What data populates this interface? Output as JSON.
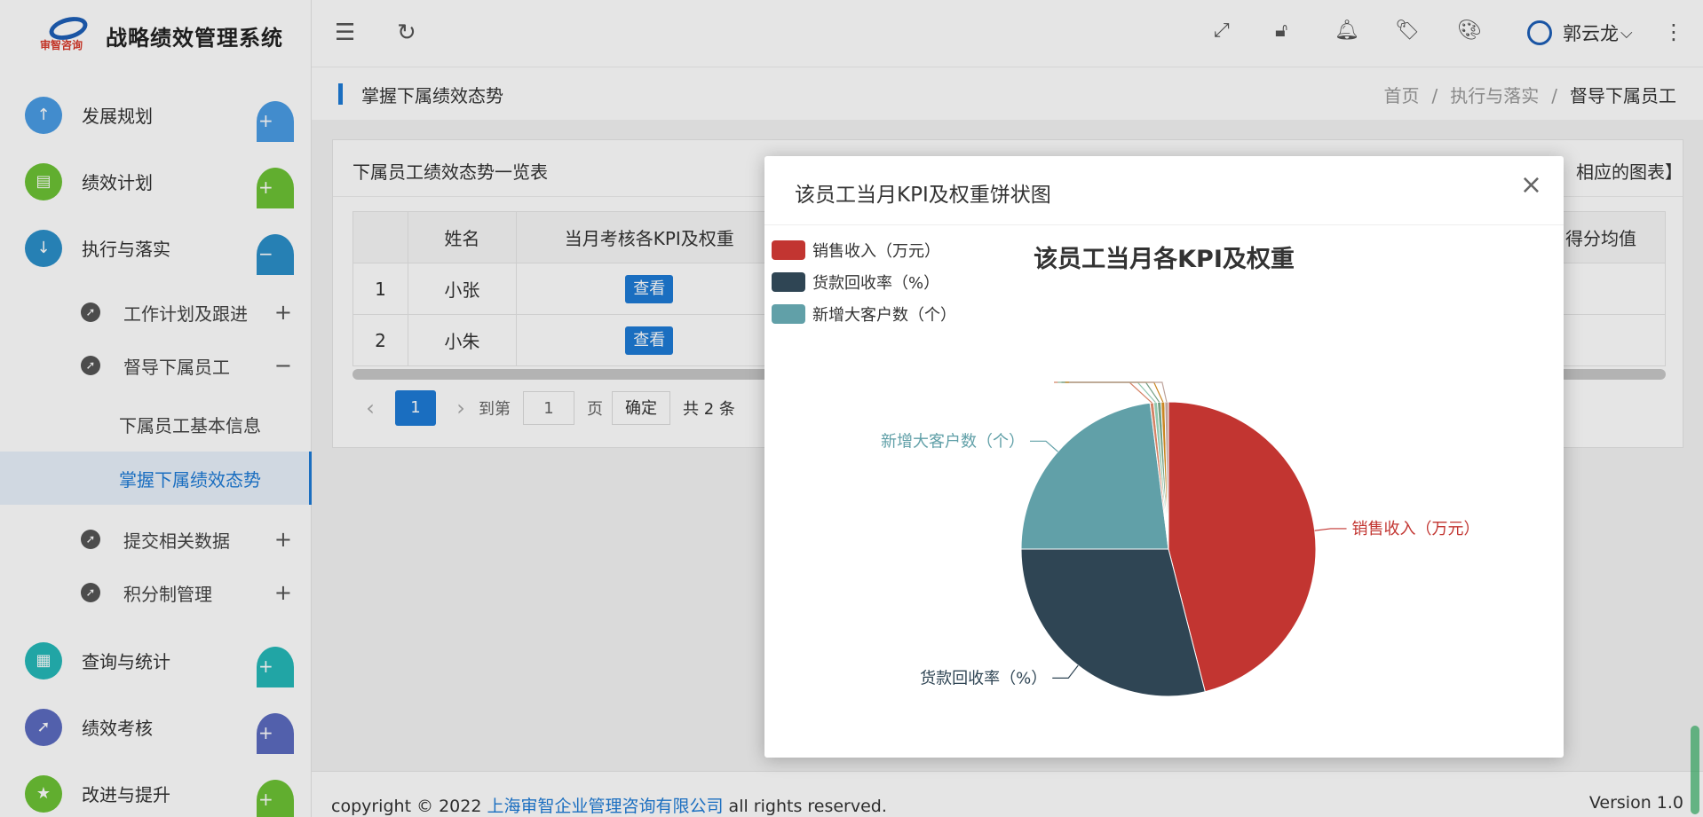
{
  "app": {
    "title": "战略绩效管理系统",
    "logo_text": "审智咨询"
  },
  "sidebar": {
    "items": [
      {
        "label": "发展规划",
        "color": "#4a9ce5"
      },
      {
        "label": "绩效计划",
        "color": "#6cc235"
      },
      {
        "label": "执行与落实",
        "color": "#2b8fc9"
      },
      {
        "label": "查询与统计",
        "color": "#25b8b8"
      },
      {
        "label": "绩效考核",
        "color": "#5c6bc0"
      },
      {
        "label": "改进与提升",
        "color": "#6cc235"
      }
    ],
    "sub_items": [
      {
        "label": "工作计划及跟进",
        "toggle": "+"
      },
      {
        "label": "督导下属员工",
        "toggle": "−"
      },
      {
        "label": "提交相关数据",
        "toggle": "+"
      },
      {
        "label": "积分制管理",
        "toggle": "+"
      }
    ],
    "leaf_items": [
      {
        "label": "下属员工基本信息"
      },
      {
        "label": "掌握下属绩效态势"
      }
    ]
  },
  "header": {
    "user_name": "郭云龙"
  },
  "subbar": {
    "page_title": "掌握下属绩效态势",
    "breadcrumb": [
      "首页",
      "执行与落实",
      "督导下属员工"
    ],
    "separator": "/"
  },
  "card": {
    "title": "下属员工绩效态势一览表",
    "hint": "相应的图表】",
    "columns": [
      "",
      "姓名",
      "当月考核各KPI及权重",
      "得分均值"
    ],
    "rows": [
      {
        "index": "1",
        "name": "小张",
        "action": "查看"
      },
      {
        "index": "2",
        "name": "小朱",
        "action": "查看"
      }
    ],
    "pager": {
      "current": "1",
      "goto_label": "到第",
      "goto_value": "1",
      "page_unit": "页",
      "confirm": "确定",
      "total": "共 2 条"
    }
  },
  "footer": {
    "prefix": "copyright © 2022 ",
    "company": "上海审智企业管理咨询有限公司",
    "suffix": " all rights reserved.",
    "version": "Version 1.0"
  },
  "modal": {
    "title": "该员工当月KPI及权重饼状图",
    "close": "×"
  },
  "chart_data": {
    "type": "pie",
    "title": "该员工当月各KPI及权重",
    "legend_position": "top-left",
    "series": [
      {
        "name": "销售收入（万元）",
        "value": 46,
        "color": "#c23531"
      },
      {
        "name": "货款回收率（%）",
        "value": 29,
        "color": "#2f4554"
      },
      {
        "name": "新增大客户数（个）",
        "value": 23,
        "color": "#61a0a8"
      },
      {
        "name": "",
        "value": 0.4,
        "color": "#d48265"
      },
      {
        "name": "",
        "value": 0.4,
        "color": "#91c7ae"
      },
      {
        "name": "",
        "value": 0.4,
        "color": "#749f83"
      },
      {
        "name": "",
        "value": 0.4,
        "color": "#ca8622"
      },
      {
        "name": "",
        "value": 0.4,
        "color": "#bda29a"
      }
    ]
  }
}
